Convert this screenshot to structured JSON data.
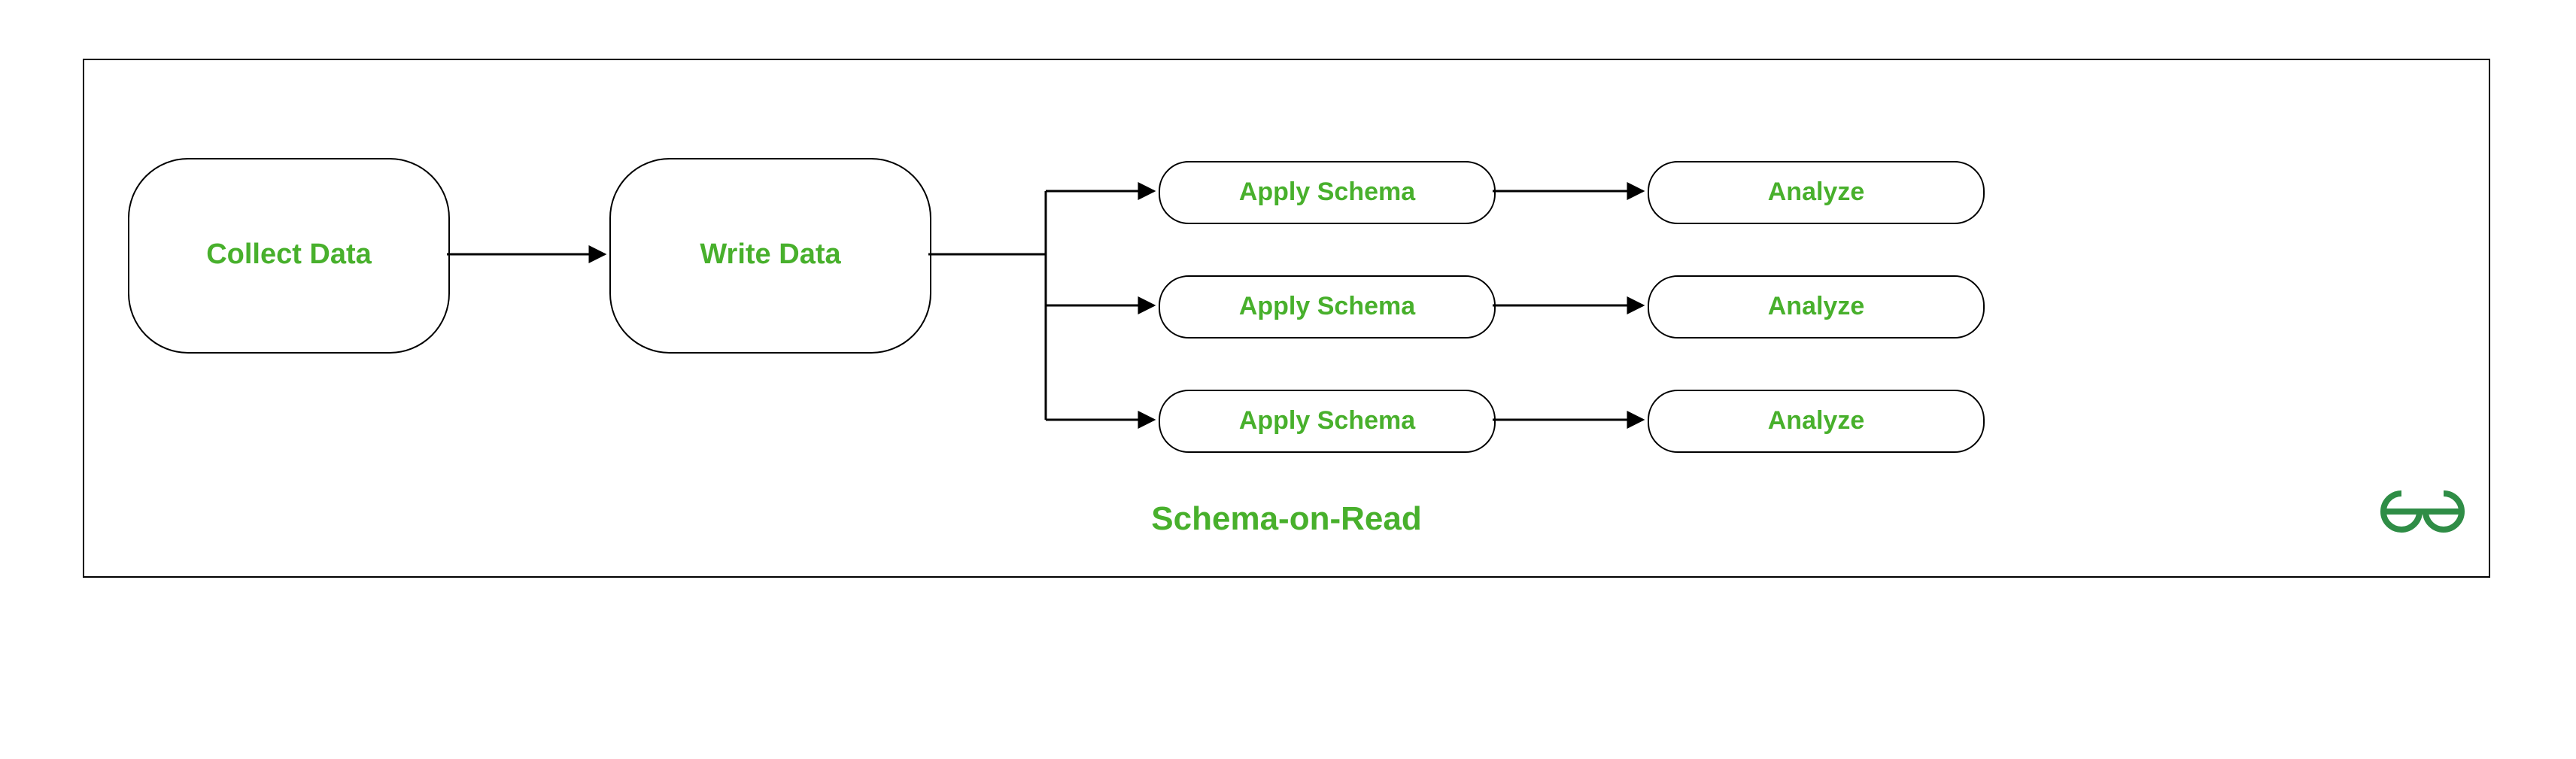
{
  "caption": "Schema-on-Read",
  "nodes": {
    "collect": "Collect Data",
    "write": "Write Data",
    "apply1": "Apply Schema",
    "apply2": "Apply Schema",
    "apply3": "Apply Schema",
    "analyze1": "Analyze",
    "analyze2": "Analyze",
    "analyze3": "Analyze"
  },
  "colors": {
    "text_green": "#48b02c",
    "logo_green": "#2f8d46",
    "border": "#000000"
  }
}
